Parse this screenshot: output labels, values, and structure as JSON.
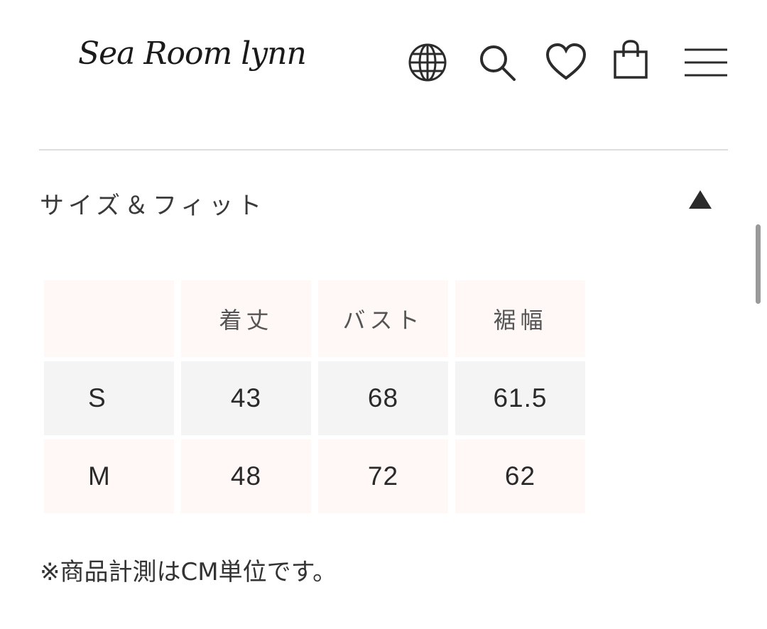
{
  "header": {
    "logo_text": "Sea Room lynn",
    "icons": [
      "globe-icon",
      "search-icon",
      "heart-icon",
      "shopping-bag-icon",
      "hamburger-menu-icon"
    ]
  },
  "section": {
    "title": "サイズ＆フィット",
    "toggle_icon": "triangle-up-icon"
  },
  "size_table": {
    "headers": [
      "",
      "着丈",
      "バスト",
      "裾幅"
    ],
    "rows": [
      {
        "size": "S",
        "values": [
          "43",
          "68",
          "61.5"
        ]
      },
      {
        "size": "M",
        "values": [
          "48",
          "72",
          "62"
        ]
      }
    ]
  },
  "note": "※商品計測はCM単位です。",
  "colors": {
    "header_row_bg": "#fff8f6",
    "striped_row_bg": "#f4f4f4",
    "text": "#333333",
    "divider": "#dedede"
  }
}
